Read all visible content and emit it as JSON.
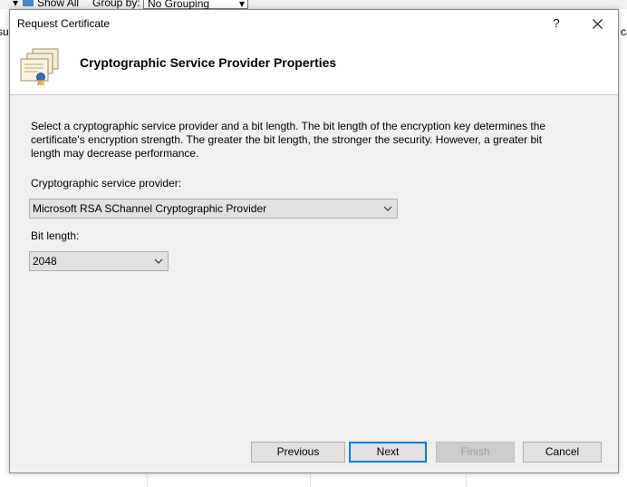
{
  "background": {
    "show_all": "Show All",
    "group_by_label": "Group by:",
    "group_by_value": "No Grouping",
    "left_fragment": "su",
    "right_fragment": "ca"
  },
  "dialog": {
    "title": "Request Certificate",
    "help_glyph": "?",
    "close_glyph": "✕",
    "heading": "Cryptographic Service Provider Properties",
    "description": "Select a cryptographic service provider and a bit length. The bit length of the encryption key determines the certificate's encryption strength. The greater the bit length, the stronger the security. However, a greater bit length may decrease performance.",
    "csp_label": "Cryptographic service provider:",
    "csp_value": "Microsoft RSA SChannel Cryptographic Provider",
    "bit_length_label": "Bit length:",
    "bit_length_value": "2048",
    "buttons": {
      "previous": "Previous",
      "next": "Next",
      "finish": "Finish",
      "cancel": "Cancel"
    }
  }
}
